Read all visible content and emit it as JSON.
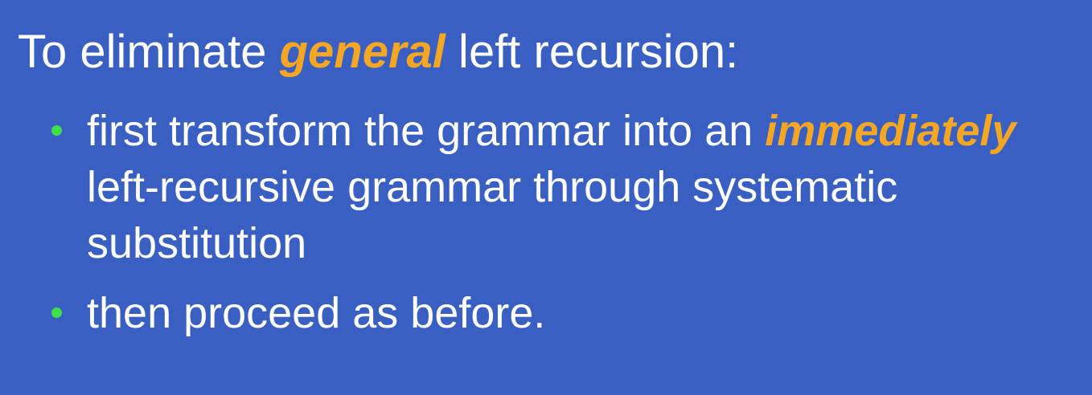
{
  "heading": {
    "prefix": "To eliminate ",
    "emphasis": "general",
    "suffix": " left recursion:"
  },
  "bullets": [
    {
      "prefix": "first transform the grammar into an ",
      "emphasis": "immediately",
      "suffix": " left-recursive grammar through systematic substitution"
    },
    {
      "text": "then proceed as before."
    }
  ],
  "colors": {
    "background": "#3a5fc3",
    "text": "#ffffff",
    "emphasis": "#f5a623",
    "bullet_dot": "#3fe04a"
  }
}
